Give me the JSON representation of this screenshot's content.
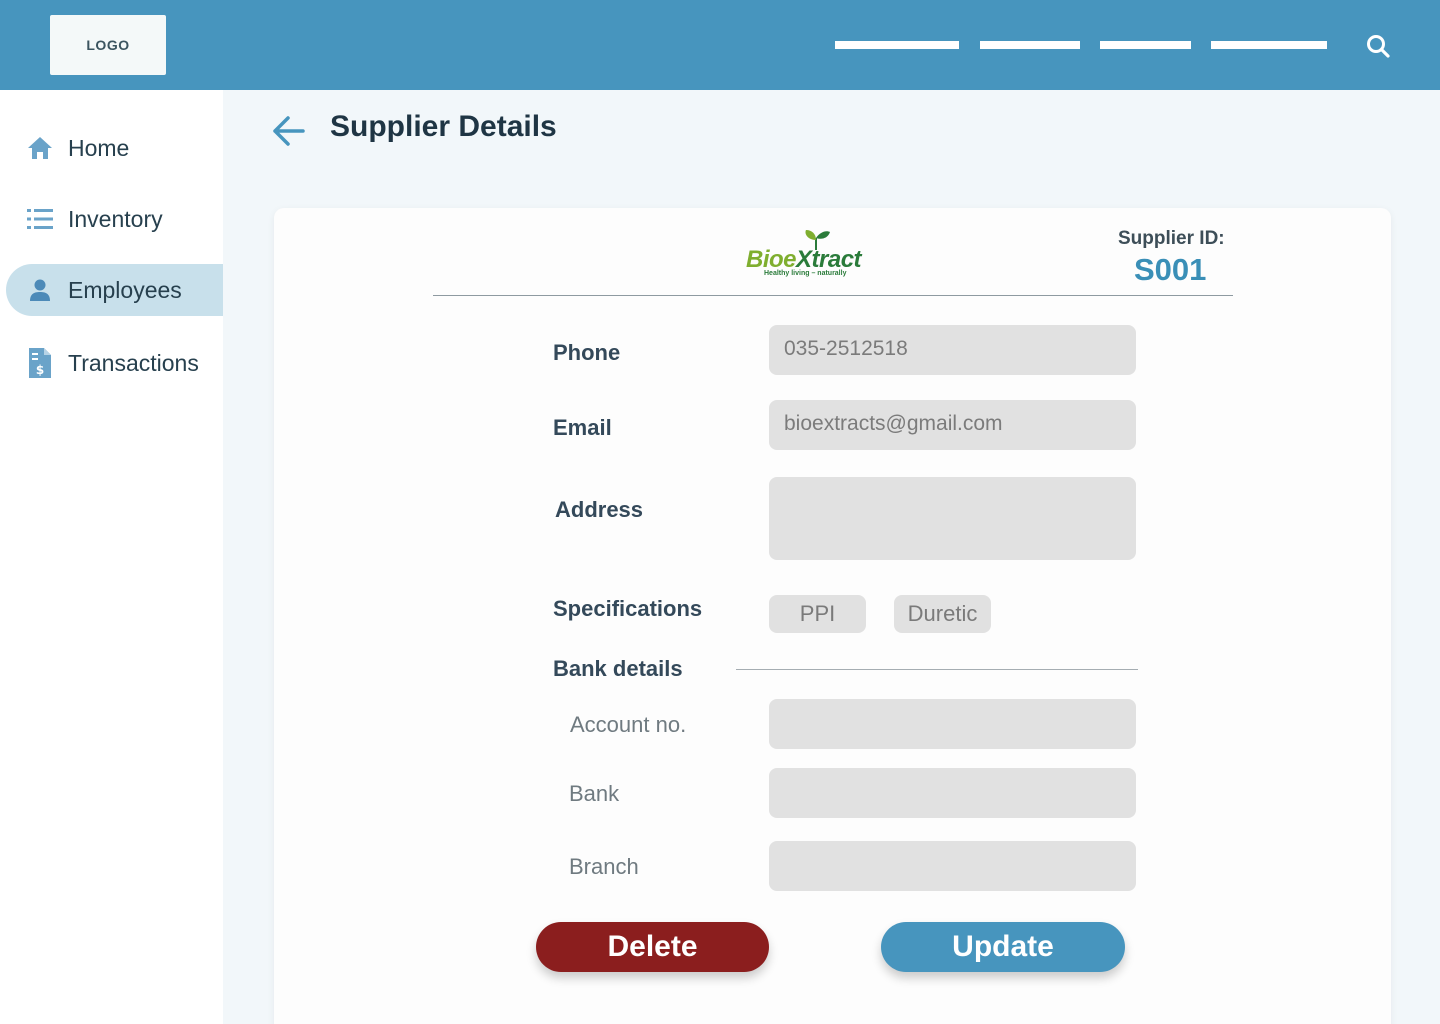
{
  "header": {
    "logo_text": "LOGO",
    "search_icon": "search-icon"
  },
  "sidebar": {
    "items": [
      {
        "label": "Home",
        "icon": "home-icon",
        "active": false
      },
      {
        "label": "Inventory",
        "icon": "list-icon",
        "active": false
      },
      {
        "label": "Employees",
        "icon": "person-icon",
        "active": true
      },
      {
        "label": "Transactions",
        "icon": "invoice-dollar-icon",
        "active": false
      }
    ]
  },
  "page": {
    "title": "Supplier Details",
    "back_icon": "arrow-left-icon"
  },
  "supplier": {
    "brand_name_part1": "Bioe",
    "brand_name_part2": "Xtract",
    "brand_tagline": "Healthy living – naturally",
    "id_label": "Supplier ID:",
    "id_value": "S001"
  },
  "form": {
    "phone_label": "Phone",
    "phone_value": "035-2512518",
    "email_label": "Email",
    "email_value": "bioextracts@gmail.com",
    "address_label": "Address",
    "address_value": "",
    "specifications_label": "Specifications",
    "specifications": [
      "PPI",
      "Duretic"
    ],
    "bank_details_label": "Bank details",
    "account_label": "Account no.",
    "account_value": "",
    "bank_label": "Bank",
    "bank_value": "",
    "branch_label": "Branch",
    "branch_value": ""
  },
  "actions": {
    "delete_label": "Delete",
    "update_label": "Update"
  },
  "colors": {
    "primary": "#4795be",
    "danger": "#8b1e1e",
    "active_nav": "#c8e0eb",
    "supplier_id": "#3a8fb7"
  }
}
